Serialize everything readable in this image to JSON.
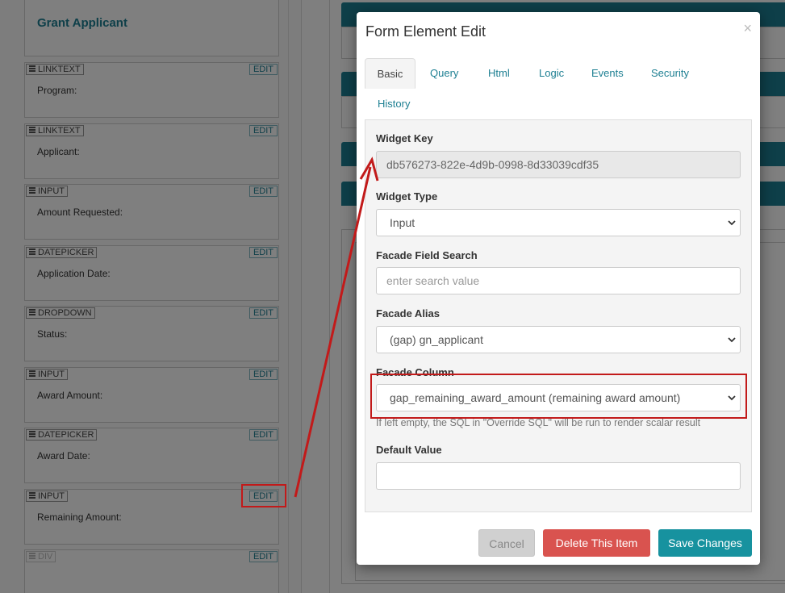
{
  "background": {
    "form_title": "Grant Applicant",
    "widgets": [
      {
        "type": "LINKTEXT",
        "label": "Program:"
      },
      {
        "type": "LINKTEXT",
        "label": "Applicant:"
      },
      {
        "type": "INPUT",
        "label": "Amount Requested:"
      },
      {
        "type": "DATEPICKER",
        "label": "Application Date:"
      },
      {
        "type": "DROPDOWN",
        "label": "Status:"
      },
      {
        "type": "INPUT",
        "label": "Award Amount:"
      },
      {
        "type": "DATEPICKER",
        "label": "Award Date:"
      },
      {
        "type": "INPUT",
        "label": "Remaining Amount:"
      },
      {
        "type": "DIV",
        "label": ""
      }
    ],
    "edit_label": "EDIT"
  },
  "modal": {
    "title": "Form Element Edit",
    "close": "×",
    "tabs": [
      "Basic",
      "Query",
      "Html",
      "Logic",
      "Events",
      "Security",
      "History"
    ],
    "active_tab": "Basic",
    "fields": {
      "widget_key": {
        "label": "Widget Key",
        "value": "db576273-822e-4d9b-0998-8d33039cdf35"
      },
      "widget_type": {
        "label": "Widget Type",
        "value": "Input"
      },
      "facade_field_search": {
        "label": "Facade Field Search",
        "placeholder": "enter search value"
      },
      "facade_alias": {
        "label": "Facade Alias",
        "value": "(gap) gn_applicant"
      },
      "facade_column": {
        "label": "Facade Column",
        "value": "gap_remaining_award_amount (remaining award amount)",
        "hint": "If left empty, the SQL in \"Override SQL\" will be run to render scalar result"
      },
      "default_value": {
        "label": "Default Value",
        "value": ""
      }
    },
    "buttons": {
      "cancel": "Cancel",
      "delete": "Delete This Item",
      "save": "Save Changes"
    }
  },
  "colors": {
    "accent": "#1d7f92",
    "danger": "#d9534f",
    "save": "#17929f",
    "annotation": "#c21a1a"
  }
}
